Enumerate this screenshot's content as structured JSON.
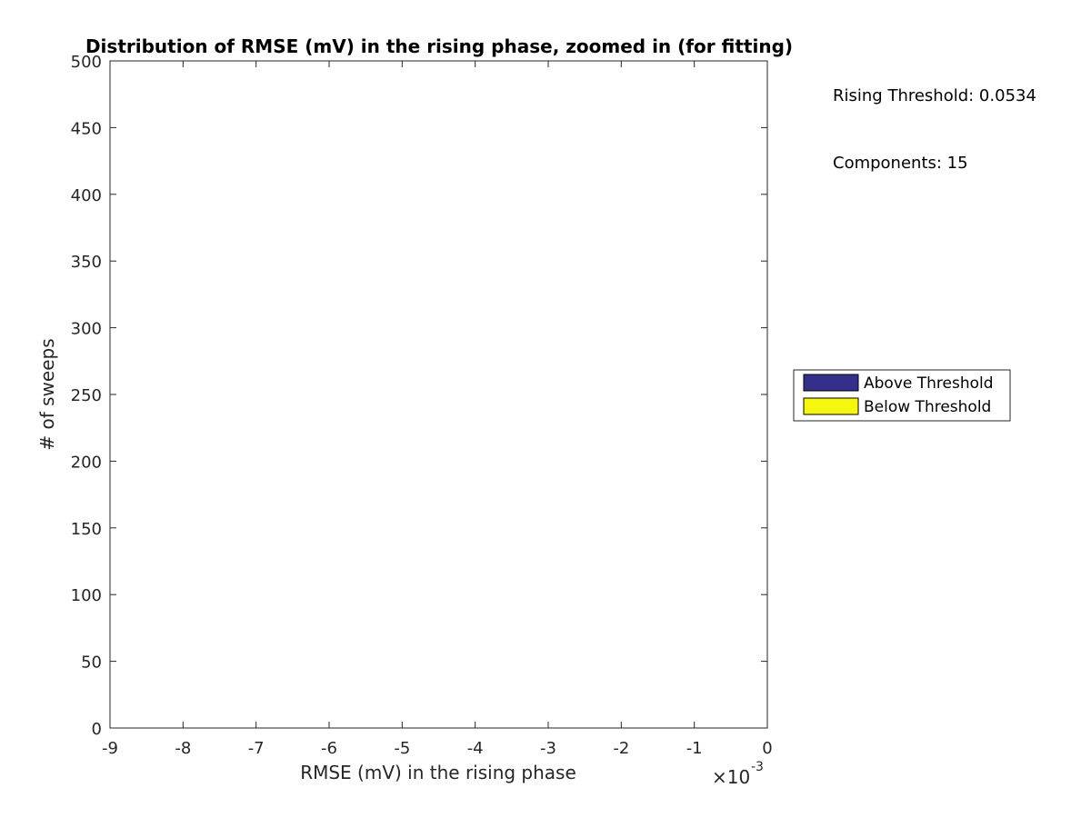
{
  "chart_data": {
    "type": "bar",
    "title": "Distribution of RMSE (mV) in the rising phase, zoomed in (for fitting)",
    "xlabel": "RMSE (mV) in the rising phase",
    "ylabel": "# of sweeps",
    "x_exponent_label": "×10",
    "x_exponent_power": "-3",
    "xlim": [
      -9,
      0
    ],
    "ylim": [
      0,
      500
    ],
    "xticks": [
      -9,
      -8,
      -7,
      -6,
      -5,
      -4,
      -3,
      -2,
      -1,
      0
    ],
    "xtick_labels": [
      "-9",
      "-8",
      "-7",
      "-6",
      "-5",
      "-4",
      "-3",
      "-2",
      "-1",
      "0"
    ],
    "yticks": [
      0,
      50,
      100,
      150,
      200,
      250,
      300,
      350,
      400,
      450,
      500
    ],
    "ytick_labels": [
      "0",
      "50",
      "100",
      "150",
      "200",
      "250",
      "300",
      "350",
      "400",
      "450",
      "500"
    ],
    "grid": false,
    "series": [
      {
        "name": "Above Threshold",
        "color": "#332f8a",
        "values": []
      },
      {
        "name": "Below Threshold",
        "color": "#f5f80e",
        "values": []
      }
    ],
    "legend": {
      "position": "right",
      "entries": [
        {
          "label": "Above Threshold",
          "color": "#332f8a"
        },
        {
          "label": "Below Threshold",
          "color": "#f5f80e"
        }
      ]
    },
    "annotations": [
      "Rising Threshold: 0.0534",
      "Components: 15"
    ]
  }
}
